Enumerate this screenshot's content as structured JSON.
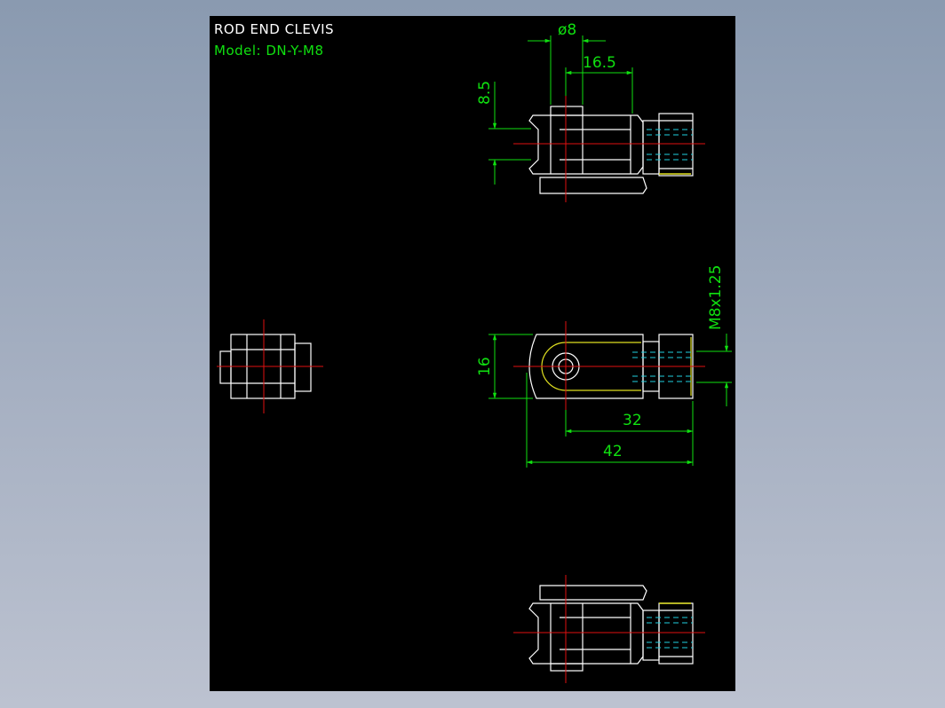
{
  "title_block": {
    "title": "ROD END CLEVIS",
    "model": "Model: DN-Y-M8"
  },
  "dimensions": {
    "pin_diameter": "ø8",
    "pin_offset": "16.5",
    "fork_height": "8.5",
    "body_width": "16",
    "thread_spec": "M8x1.25",
    "hole_to_end": "32",
    "overall_length": "42"
  },
  "colors": {
    "background": "#000000",
    "outline": "#ffffff",
    "dimension": "#10e010",
    "centerline": "#e01010",
    "hidden": "#20d0e0",
    "highlight": "#e0e020"
  }
}
